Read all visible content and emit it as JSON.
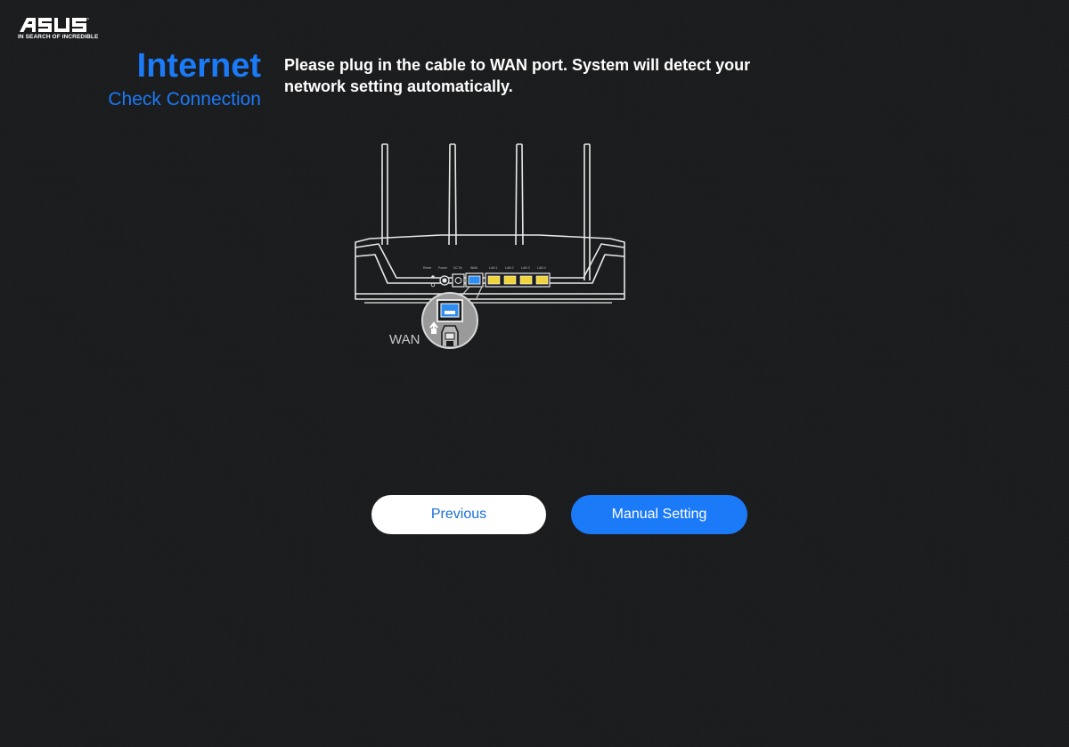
{
  "brand": {
    "logo_text": "ASUS",
    "tagline": "IN SEARCH OF INCREDIBLE"
  },
  "header": {
    "title": "Internet",
    "subtitle": "Check Connection"
  },
  "main": {
    "instruction": "Please plug in the cable to WAN port. System will detect your network setting automatically.",
    "figure": {
      "port_label": "WAN",
      "icons": [
        "router-icon",
        "ethernet-port-icon",
        "ethernet-plug-icon",
        "arrow-up-icon"
      ]
    }
  },
  "buttons": {
    "previous_label": "Previous",
    "manual_label": "Manual Setting"
  },
  "colors": {
    "accent": "#1a7af8",
    "background": "#1b1c1e",
    "wan_port": "#2f8df0",
    "lan_port": "#f0d43a"
  }
}
